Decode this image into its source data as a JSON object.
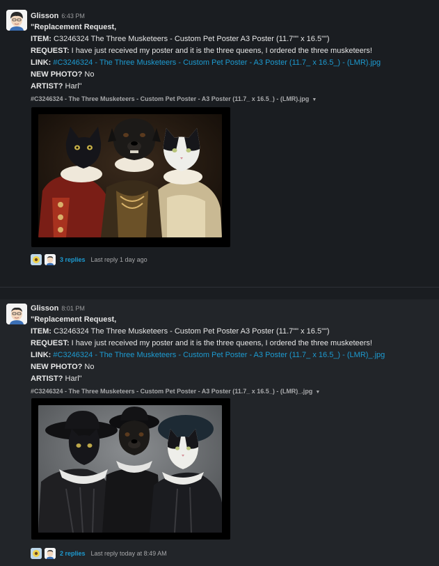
{
  "messages": [
    {
      "author": "Glisson",
      "time": "6:43 PM",
      "line1": "\"Replacement Request,",
      "item_label": "ITEM:",
      "item_value": " C3246324 The Three Musketeers - Custom Pet Poster A3 Poster (11.7\"\" x 16.5\"\")",
      "request_label": "REQUEST:",
      "request_value": " I have just received my poster and it is the three queens, I ordered the three musketeers!",
      "link_label": "LINK:",
      "link_value": " #C3246324 - The Three Musketeers - Custom Pet Poster - A3 Poster (11.7_ x 16.5_) - (LMR).jpg",
      "photo_label": "NEW PHOTO?",
      "photo_value": " No",
      "artist_label": "ARTIST?",
      "artist_value": " Harl\"",
      "file_name": "#C3246324 - The Three Musketeers - Custom Pet Poster - A3 Poster (11.7_ x 16.5_) - (LMR).jpg",
      "replies": "3 replies",
      "last_reply": "Last reply 1 day ago"
    },
    {
      "author": "Glisson",
      "time": "8:01 PM",
      "line1": "\"Replacement Request,",
      "item_label": "ITEM:",
      "item_value": " C3246324 The Three Musketeers - Custom Pet Poster A3 Poster (11.7\"\" x 16.5\"\")",
      "request_label": "REQUEST:",
      "request_value": " I have just received my poster and it is the three queens, I ordered the three musketeers!",
      "link_label": "LINK:",
      "link_value": " #C3246324 - The Three Musketeers - Custom Pet Poster - A3 Poster (11.7_ x 16.5_) - (LMR)_.jpg",
      "photo_label": "NEW PHOTO?",
      "photo_value": " No",
      "artist_label": "ARTIST?",
      "artist_value": " Harl\"",
      "file_name": "#C3246324 - The Three Musketeers - Custom Pet Poster - A3 Poster (11.7_ x 16.5_) - (LMR)_.jpg",
      "replies": "2 replies",
      "last_reply": "Last reply today at 8:49 AM"
    }
  ],
  "icons": {
    "avatar": "cartoon-user-avatar-icon",
    "caret": "caret-down-icon",
    "reply_avatar_1": "flower-avatar-icon",
    "reply_avatar_2": "cartoon-user-avatar-icon"
  },
  "colors": {
    "background": "#1a1d21",
    "highlight_row": "#222529",
    "link": "#1d9bd1",
    "text": "#e6e6e6",
    "muted": "#a8a9ab"
  }
}
